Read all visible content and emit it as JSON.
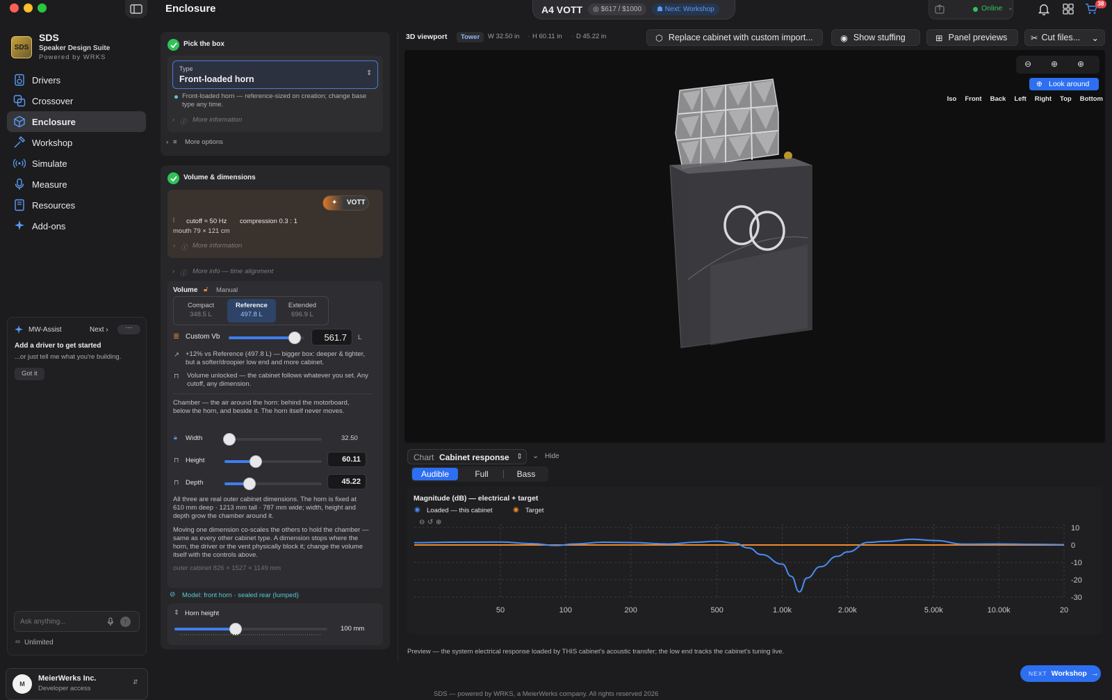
{
  "window": {
    "page_title": "Enclosure"
  },
  "project": {
    "name": "A4 VOTT",
    "budget": "$617 / $1000",
    "next": "Next: Workshop"
  },
  "status": {
    "online": "Online",
    "cart_count": "38"
  },
  "brand": {
    "name": "SDS",
    "subtitle": "Speaker Design Suite",
    "powered": "Powered by WRKS",
    "logo_text": "SDS"
  },
  "nav": [
    {
      "label": "Drivers",
      "icon": "drivers-icon"
    },
    {
      "label": "Crossover",
      "icon": "crossover-icon"
    },
    {
      "label": "Enclosure",
      "icon": "enclosure-icon",
      "active": true
    },
    {
      "label": "Workshop",
      "icon": "hammer-icon"
    },
    {
      "label": "Simulate",
      "icon": "simulate-icon"
    },
    {
      "label": "Measure",
      "icon": "microphone-icon"
    },
    {
      "label": "Resources",
      "icon": "book-icon"
    },
    {
      "label": "Add-ons",
      "icon": "sparkle-icon"
    }
  ],
  "assist": {
    "title": "MW-Assist",
    "next": "Next",
    "headline": "Add a driver to get started",
    "sub": "...or just tell me what you're building.",
    "got_it": "Got it",
    "placeholder": "Ask anything...",
    "plan": "Unlimited"
  },
  "org": {
    "name": "MeierWerks Inc.",
    "role": "Developer access"
  },
  "pick_box": {
    "title": "Pick the box",
    "type_label": "Type",
    "type_value": "Front-loaded horn",
    "note": "Front-loaded horn — reference-sized on creation; change base type any time.",
    "more_info": "More information",
    "more_options": "More options"
  },
  "volume_dims": {
    "title": "Volume & dimensions",
    "votte_badge": "VOTT",
    "cutoff": "cutoff ≈ 50 Hz",
    "compression": "compression 0.3 : 1",
    "mouth": "mouth 79 × 121 cm",
    "more_info": "More information",
    "more_info_time": "More info — time alignment",
    "volume_label": "Volume",
    "manual_label": "Manual",
    "presets": [
      {
        "name": "Compact",
        "value": "348.5 L"
      },
      {
        "name": "Reference",
        "value": "497.8 L",
        "active": true
      },
      {
        "name": "Extended",
        "value": "696.9 L"
      }
    ],
    "custom_vb_label": "Custom Vb",
    "custom_vb_value": "561.7",
    "custom_vb_unit": "L",
    "custom_vb_fraction": 0.88,
    "delta_note": "+12% vs Reference (497.8 L) — bigger box: deeper & tighter, but a softer/droopier low end and more cabinet.",
    "unlocked_note": "Volume unlocked — the cabinet follows whatever you set. Any cutoff, any dimension.",
    "chamber_note": "Chamber — the air around the horn: behind the motorboard, below the horn, and beside it. The horn itself never moves.",
    "width_label": "Width",
    "width_value": "32.50",
    "width_fraction": 0.05,
    "height_label": "Height",
    "height_value": "60.11",
    "height_fraction": 0.32,
    "depth_label": "Depth",
    "depth_value": "45.22",
    "depth_fraction": 0.26,
    "dims_note": "All three are real outer cabinet dimensions. The horn is fixed at 610 mm deep · 1213 mm tall · 787 mm wide; width, height and depth grow the chamber around it.",
    "scale_note": "Moving one dimension co-scales the others to hold the chamber — same as every other cabinet type. A dimension stops where the horn, the driver or the vent physically block it; change the volume itself with the controls above.",
    "outer_note": "outer cabinet 826 × 1527 × 1149 mm",
    "model_label": "Model: front horn · sealed rear (lumped)",
    "horn_height_label": "Horn height",
    "horn_height_value": "100 mm",
    "horn_height_fraction": 0.4
  },
  "viewport": {
    "label": "3D viewport",
    "tag": "Tower",
    "dims": [
      "W 32.50 in",
      "H 60.11 in",
      "D 45.22 in"
    ],
    "replace_btn": "Replace cabinet with custom import...",
    "stuffing_btn": "Show stuffing",
    "previews_btn": "Panel previews",
    "cut_btn": "Cut files...",
    "look_around": "Look around",
    "views": [
      "Iso",
      "Front",
      "Back",
      "Left",
      "Right",
      "Top",
      "Bottom"
    ]
  },
  "chart_section": {
    "chart_label": "Chart",
    "chart_value": "Cabinet response",
    "hide": "Hide",
    "tabs": [
      {
        "label": "Audible",
        "active": true
      },
      {
        "label": "Full"
      },
      {
        "label": "Bass"
      }
    ],
    "footer": "Preview — the system electrical response loaded by THIS cabinet's acoustic transfer; the low end tracks the cabinet's tuning live."
  },
  "next_button": {
    "prefix": "NEXT",
    "label": "Workshop"
  },
  "footer_text": "SDS — powered by WRKS, a MeierWerks company. All rights reserved 2026",
  "chart_data": {
    "type": "line",
    "title": "Magnitude (dB) — electrical + target",
    "xscale": "log",
    "xlim": [
      20,
      20000
    ],
    "ylim": [
      -30,
      12
    ],
    "x_ticks": [
      50,
      100,
      200,
      500,
      1000,
      2000,
      5000,
      10000,
      20000
    ],
    "x_tick_labels": [
      "50",
      "100",
      "200",
      "500",
      "1.00k",
      "2.00k",
      "5.00k",
      "10.00k",
      "20"
    ],
    "y_ticks": [
      10,
      0,
      -10,
      -20,
      -30
    ],
    "y_tick_labels": [
      "10",
      "0",
      "-10",
      "-20",
      "-30"
    ],
    "grid": true,
    "legend_placement": "top-left",
    "series": [
      {
        "name": "Loaded — this cabinet",
        "color": "#4a8df0",
        "x": [
          20,
          30,
          50,
          70,
          90,
          110,
          150,
          200,
          300,
          400,
          500,
          600,
          700,
          800,
          1000,
          1100,
          1200,
          1300,
          1500,
          1800,
          2000,
          2500,
          3000,
          4000,
          5000,
          7000,
          10000,
          15000,
          20000
        ],
        "y": [
          1.3,
          1.6,
          1.7,
          0.8,
          -0.3,
          0.6,
          1.6,
          1.4,
          0.6,
          1.6,
          2.2,
          1.1,
          -1.7,
          -5.5,
          -11,
          -18,
          -27,
          -19,
          -12.5,
          -6.5,
          -4,
          1.5,
          2.1,
          3.3,
          2.6,
          0.5,
          0.6,
          0.4,
          0.2
        ]
      },
      {
        "name": "Target",
        "color": "#f08a2c",
        "x": [
          20,
          20000
        ],
        "y": [
          0,
          0
        ]
      }
    ]
  }
}
